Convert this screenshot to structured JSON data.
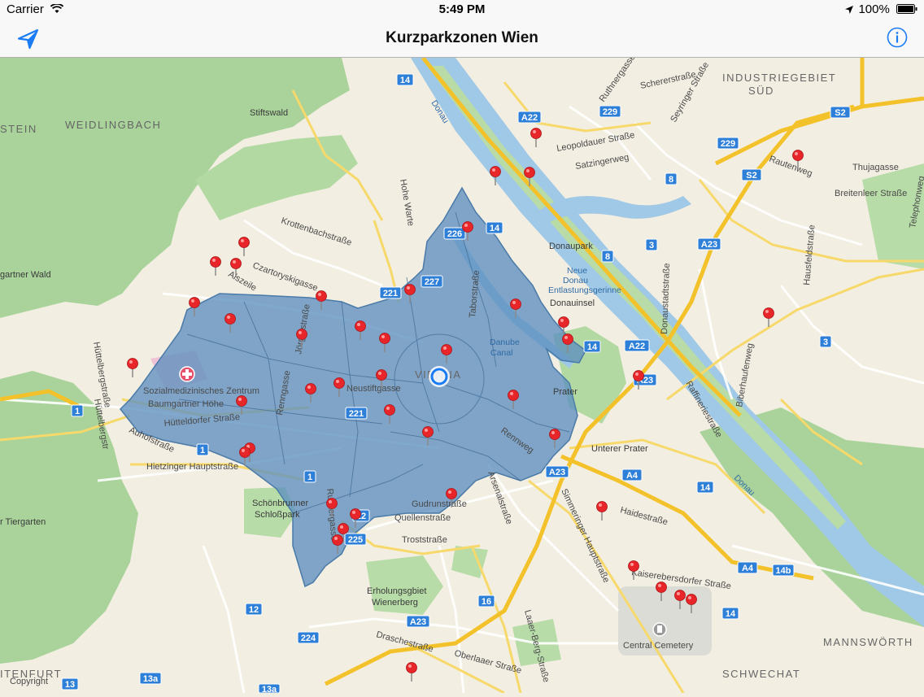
{
  "status_bar": {
    "carrier": "Carrier",
    "time": "5:49 PM",
    "battery": "100%"
  },
  "nav": {
    "title": "Kurzparkzonen Wien"
  },
  "colors": {
    "zone_fill": "#5d8fbf",
    "pin": "#e8262a",
    "park": "#a9d39a",
    "motorway": "#f3c22b",
    "water": "#9fc9e6"
  },
  "map": {
    "area_labels": [
      "INDUSTRIEGEBIET",
      "SÜD",
      "WEIDLINGBACH",
      "STEIN",
      "MANNSWÖRTH",
      "SCHWECHAT",
      "ITENFURT",
      "VIENNA"
    ],
    "poi_labels": [
      "Stiftswald",
      "gartner Wald",
      "Sozialmedizinisches Zentrum",
      "Baumgartner Höhe",
      "Schönbrunner",
      "Schloßpark",
      "r Tiergarten",
      "Erholungsgbiet",
      "Wienerberg",
      "Central Cemetery",
      "Donaupark",
      "Donauinsel",
      "Prater",
      "Unterer Prater",
      "Neustiftgasse",
      "Danube",
      "Canal",
      "Copyright"
    ],
    "water_labels": [
      "Donau",
      "Neue",
      "Donau",
      "Entlastungsgerinne",
      "Donau"
    ],
    "street_labels": [
      "Schererstraße",
      "Ruthnergasse",
      "Seyringer Straße",
      "Leopoldauer Straße",
      "Satzingerweg",
      "Rautenweg",
      "Thujagasse",
      "Breitenleer Straße",
      "Krottenbachstraße",
      "Czartoryskigasse",
      "Hohe Warte",
      "Donaustadtstraße",
      "Hausfeldstraße",
      "Biberhaufenweg",
      "Raffineriestraße",
      "Hütteldorfer Straße",
      "Auhofstraße",
      "Hietzinger Hauptstraße",
      "Hüttelbergstraße",
      "Renngasse",
      "Rennweg",
      "Arsenalstraße",
      "Gudrunstraße",
      "Quellenstraße",
      "Troststraße",
      "Ruckergasse",
      "Simmeringer Hauptstraße",
      "Haidestraße",
      "Kaiserebersdorfer Straße",
      "Laaer-Berg-Straße",
      "Oberlaaer Straße",
      "Draschestraße",
      "Taborstraße",
      "Telephonweg",
      "Jörgerstraße",
      "Alszeile",
      "Hüttelbergstr"
    ],
    "route_shields": [
      "14",
      "A22",
      "229",
      "S2",
      "229",
      "S2",
      "8",
      "226",
      "14",
      "3",
      "8",
      "A23",
      "221",
      "227",
      "A22",
      "3",
      "14",
      "A23",
      "221",
      "1",
      "1",
      "1",
      "A23",
      "A4",
      "14",
      "12",
      "225",
      "A4",
      "14b",
      "12",
      "16",
      "A23",
      "224",
      "14",
      "13",
      "13a",
      "13a"
    ]
  }
}
